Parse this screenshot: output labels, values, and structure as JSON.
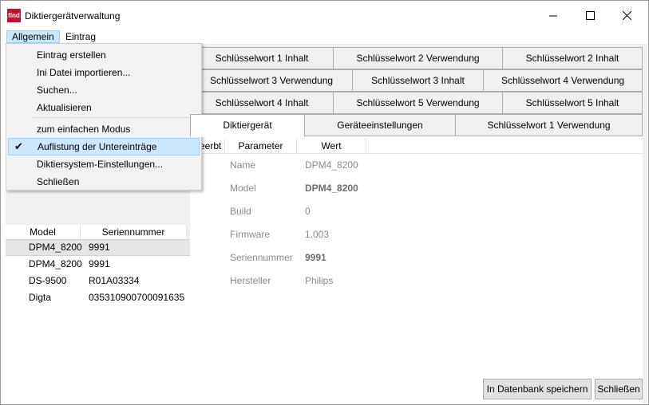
{
  "window": {
    "title": "Diktiergerätverwaltung",
    "logo_text": "find",
    "controls": {
      "minimize": "—",
      "maximize": "☐",
      "close": "✕"
    }
  },
  "menubar": {
    "items": [
      "Allgemein",
      "Eintrag"
    ]
  },
  "dropdown": {
    "items": [
      {
        "label": "Eintrag erstellen"
      },
      {
        "label": "Ini Datei importieren..."
      },
      {
        "label": "Suchen..."
      },
      {
        "label": "Aktualisieren"
      },
      {
        "label": "zum einfachen Modus"
      },
      {
        "label": "Auflistung der Untereinträge",
        "checked": true
      },
      {
        "label": "Diktiersystem-Einstellungen..."
      },
      {
        "label": "Schließen"
      }
    ],
    "check_glyph": "✔"
  },
  "tabs": {
    "row1": [
      "Schlüsselwort 1 Inhalt",
      "Schlüsselwort 2 Verwendung",
      "Schlüsselwort 2 Inhalt"
    ],
    "row2": [
      "Schlüsselwort 3 Verwendung",
      "Schlüsselwort 3 Inhalt",
      "Schlüsselwort 4 Verwendung"
    ],
    "row3": [
      "Schlüsselwort 4 Inhalt",
      "Schlüsselwort 5 Verwendung",
      "Schlüsselwort 5 Inhalt"
    ],
    "row4": [
      "Diktiergerät",
      "Geräteeinstellungen",
      "Schlüsselwort 1 Verwendung"
    ],
    "selected": "Diktiergerät"
  },
  "property_grid": {
    "headers": [
      "eerbt",
      "Parameter",
      "Wert"
    ],
    "rows": [
      {
        "param": "Name",
        "value": "DPM4_8200",
        "bold": false
      },
      {
        "param": "Model",
        "value": "DPM4_8200",
        "bold": true
      },
      {
        "param": "Build",
        "value": "0",
        "bold": false
      },
      {
        "param": "Firmware",
        "value": "1.003",
        "bold": false
      },
      {
        "param": "Seriennummer",
        "value": "9991",
        "bold": true
      },
      {
        "param": "Hersteller",
        "value": "Philips",
        "bold": false
      }
    ]
  },
  "device_list": {
    "headers": [
      "Model",
      "Seriennummer"
    ],
    "rows": [
      {
        "model": "DPM4_8200",
        "serial": "9991",
        "selected": true
      },
      {
        "model": "DPM4_8200",
        "serial": "9991"
      },
      {
        "model": "DS-9500",
        "serial": "R01A03334"
      },
      {
        "model": "Digta",
        "serial": "035310900700091635"
      }
    ]
  },
  "buttons": {
    "save": "In Datenbank speichern",
    "close": "Schließen"
  },
  "colors": {
    "menu_highlight": "#cce8ff",
    "menu_highlight_border": "#99d1ff",
    "panel_bg": "#f0f0f0"
  }
}
